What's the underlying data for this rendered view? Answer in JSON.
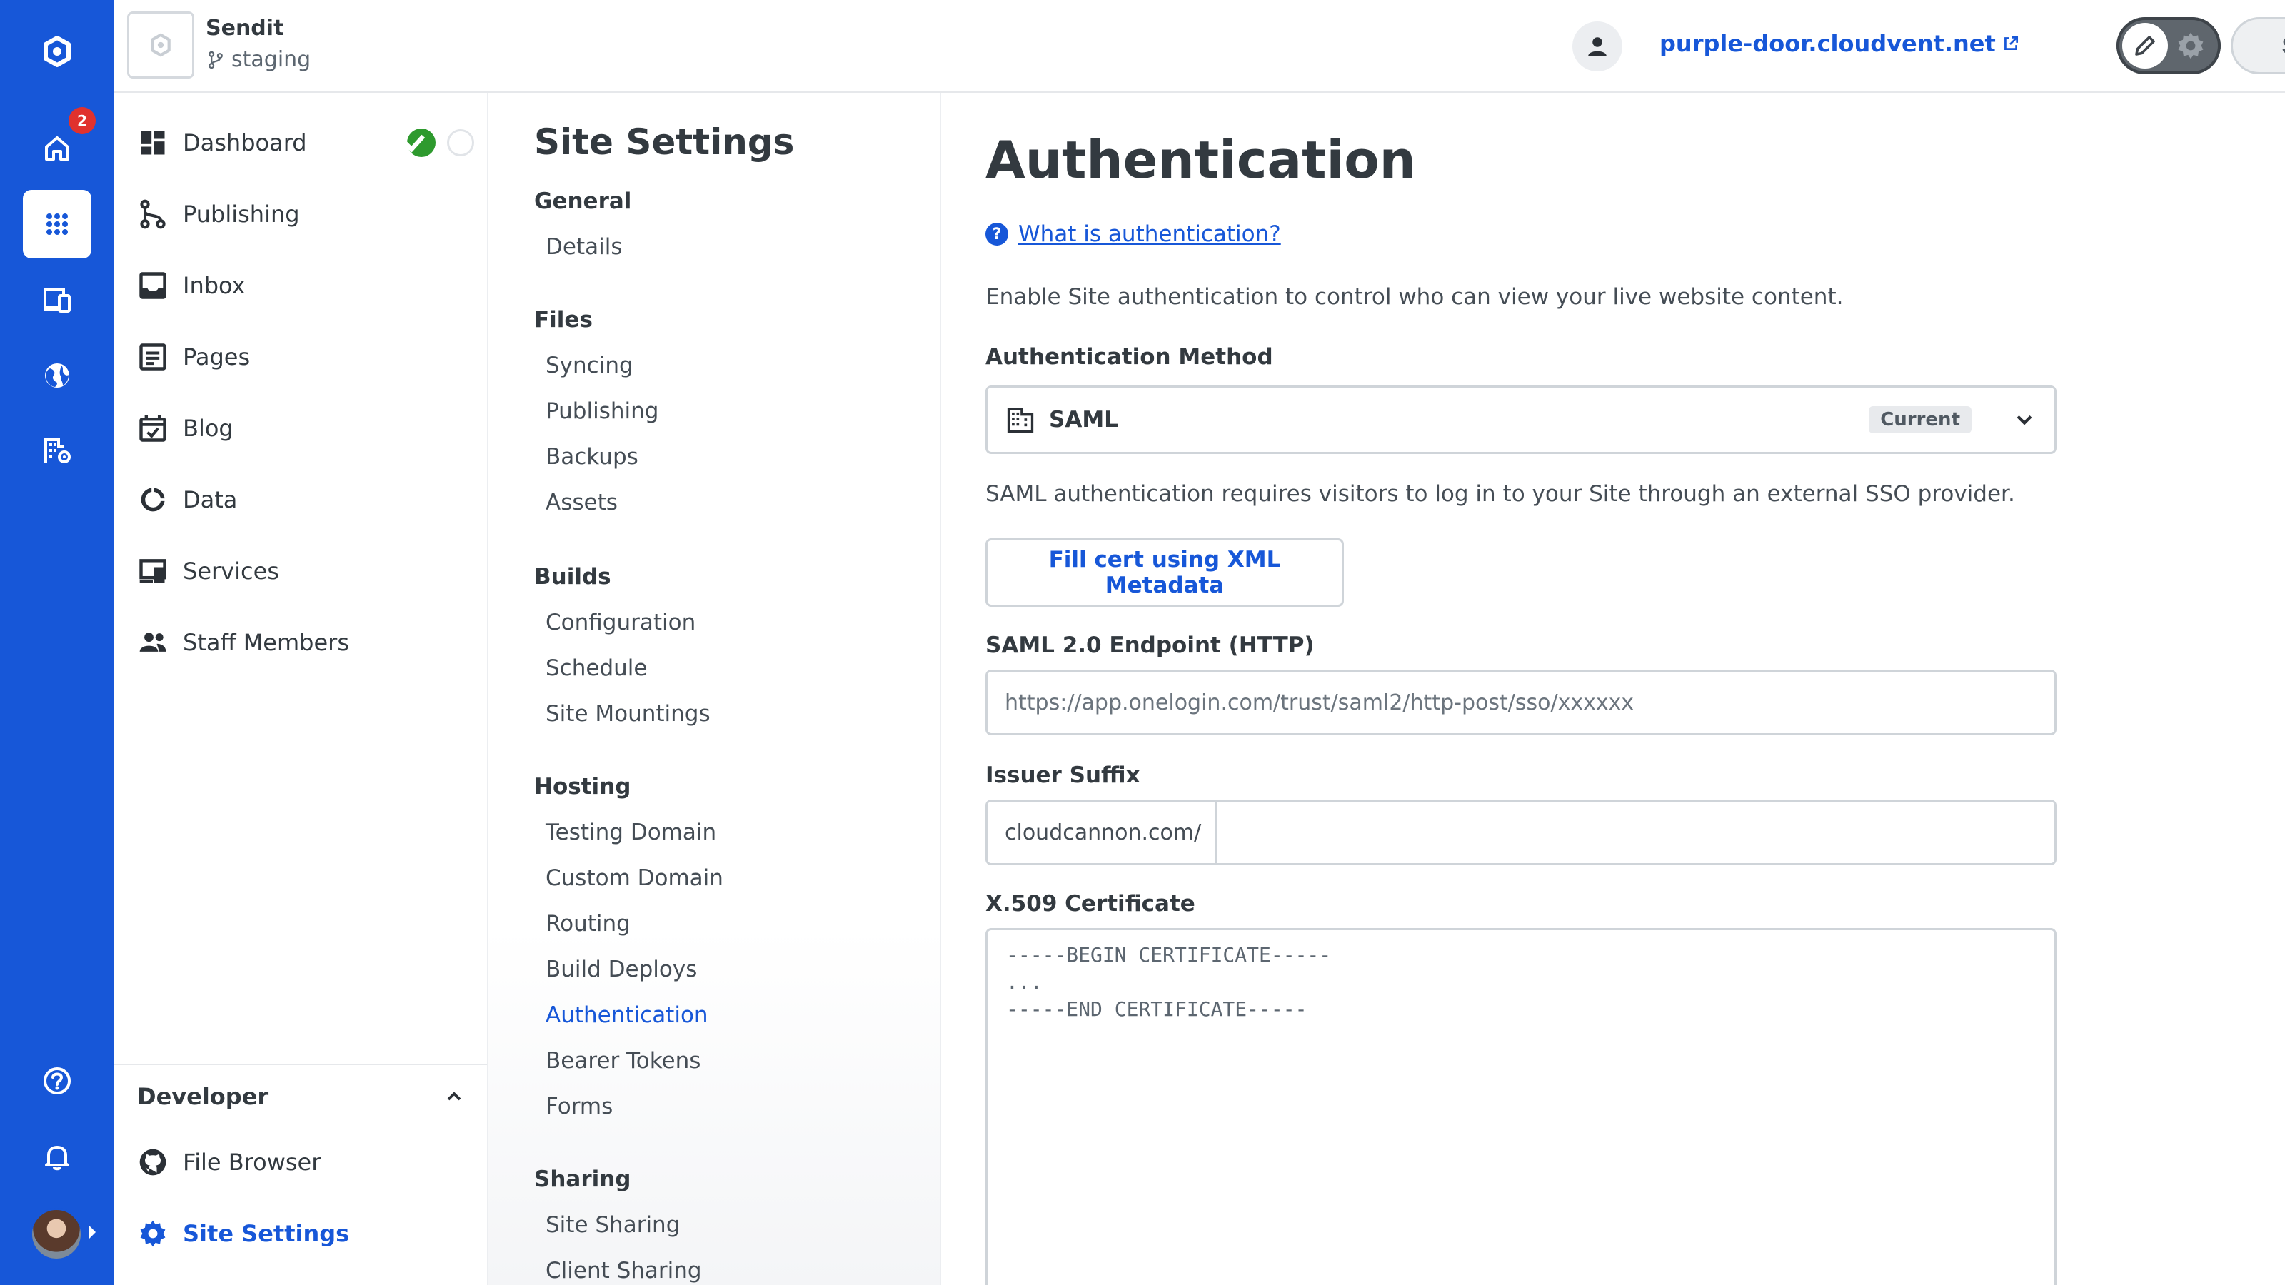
{
  "topbar": {
    "site_name": "Sendit",
    "branch": "staging",
    "site_url": "purple-door.cloudvent.net",
    "save_label": "Save"
  },
  "rail": {
    "home_badge": "2",
    "items": [
      "logo-icon",
      "home-icon",
      "apps-icon",
      "devices-icon",
      "globe-icon",
      "org-settings-icon",
      "help-icon",
      "bell-icon",
      "avatar"
    ]
  },
  "nav": {
    "items": [
      {
        "label": "Dashboard",
        "icon": "dashboard-icon"
      },
      {
        "label": "Publishing",
        "icon": "branch-icon"
      },
      {
        "label": "Inbox",
        "icon": "inbox-icon"
      },
      {
        "label": "Pages",
        "icon": "pages-icon"
      },
      {
        "label": "Blog",
        "icon": "calendar-check-icon"
      },
      {
        "label": "Data",
        "icon": "data-icon"
      },
      {
        "label": "Services",
        "icon": "services-icon"
      },
      {
        "label": "Staff Members",
        "icon": "people-icon"
      }
    ],
    "developer": {
      "heading": "Developer",
      "items": [
        {
          "label": "File Browser",
          "icon": "github-icon"
        },
        {
          "label": "Site Settings",
          "icon": "gear-icon",
          "active": true
        }
      ]
    }
  },
  "settings_nav": {
    "title": "Site Settings",
    "groups": [
      {
        "heading": "General",
        "links": [
          "Details"
        ]
      },
      {
        "heading": "Files",
        "links": [
          "Syncing",
          "Publishing",
          "Backups",
          "Assets"
        ]
      },
      {
        "heading": "Builds",
        "links": [
          "Configuration",
          "Schedule",
          "Site Mountings"
        ]
      },
      {
        "heading": "Hosting",
        "links": [
          "Testing Domain",
          "Custom Domain",
          "Routing",
          "Build Deploys",
          "Authentication",
          "Bearer Tokens",
          "Forms"
        ]
      },
      {
        "heading": "Sharing",
        "links": [
          "Site Sharing",
          "Client Sharing"
        ]
      }
    ],
    "active_link": "Authentication"
  },
  "main": {
    "title": "Authentication",
    "help_link": "What is authentication?",
    "intro": "Enable Site authentication to control who can view your live website content.",
    "method_label": "Authentication Method",
    "method_value": "SAML",
    "method_badge": "Current",
    "method_description": "SAML authentication requires visitors to log in to your Site through an external SSO provider.",
    "fill_cert_button": "Fill cert using XML Metadata",
    "endpoint_label": "SAML 2.0 Endpoint (HTTP)",
    "endpoint_placeholder": "https://app.onelogin.com/trust/saml2/http-post/sso/xxxxxx",
    "issuer_label": "Issuer Suffix",
    "issuer_prefix": "cloudcannon.com/",
    "issuer_value": "",
    "cert_label": "X.509 Certificate",
    "cert_placeholder": "-----BEGIN CERTIFICATE-----\n...\n-----END CERTIFICATE-----"
  },
  "colors": {
    "brand": "#1757d8",
    "status_ok": "#2e9a2e",
    "badge": "#e0322e"
  }
}
